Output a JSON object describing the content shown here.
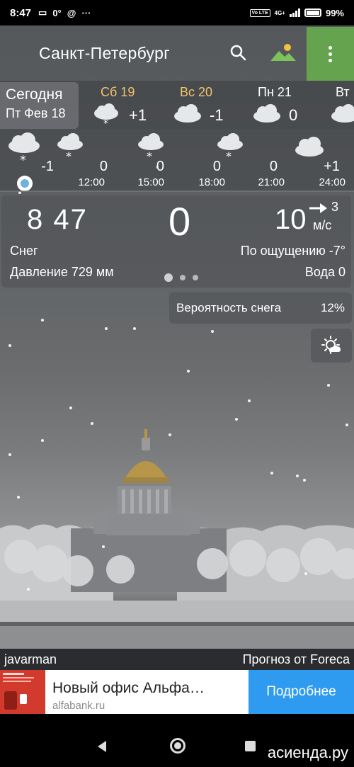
{
  "status_bar": {
    "time": "8:47",
    "icons": [
      "message-icon",
      "temperature-0-icon",
      "at-icon",
      "more-icon"
    ],
    "temp_badge": "0°",
    "more": "···",
    "network": "4G+",
    "volte": "Vo LTE",
    "battery": "99%"
  },
  "app_bar": {
    "city": "Санкт-Петербург",
    "accent_color": "#66a34e"
  },
  "days": {
    "today_label": "Сегодня",
    "today_date": "Пт Фев 18",
    "items": [
      {
        "name": "Сб 19",
        "temp": "+1",
        "icon": "cloud-snow-icon"
      },
      {
        "name": "Вс 20",
        "temp": "-1",
        "icon": "cloud-icon"
      },
      {
        "name": "Пн 21",
        "temp": "0",
        "icon": "cloud-icon"
      },
      {
        "name": "Вт",
        "temp": "",
        "icon": "cloud-icon"
      }
    ]
  },
  "hourly": {
    "items": [
      {
        "time": "",
        "temp": "-1",
        "icon": "cloud-snow-icon"
      },
      {
        "time": "12:00",
        "temp": "0",
        "icon": "cloud-snow-icon"
      },
      {
        "time": "15:00",
        "temp": "0",
        "icon": "cloud-snow-icon"
      },
      {
        "time": "18:00",
        "temp": "0",
        "icon": "cloud-snow-icon"
      },
      {
        "time": "21:00",
        "temp": "0",
        "icon": "cloud-icon"
      },
      {
        "time": "24:00",
        "temp": "+1",
        "icon": "cloud-icon"
      }
    ]
  },
  "current": {
    "time": "8 47",
    "temp": "0",
    "wind": "10",
    "wind_dir_value": "3",
    "wind_unit": "м/с",
    "condition": "Снег",
    "feels_like": "По ощущению -7°",
    "pressure": "Давление 729 мм",
    "water": "Вода 0"
  },
  "probability": {
    "label": "Вероятность снега",
    "value": "12%"
  },
  "credits": {
    "author": "javarman",
    "source": "Прогноз от Foreca"
  },
  "ad": {
    "title": "Новый офис Альфа…",
    "url": "alfabank.ru",
    "cta": "Подробнее",
    "cta_color": "#2e9bf0"
  },
  "watermark": "асиенда.ру"
}
